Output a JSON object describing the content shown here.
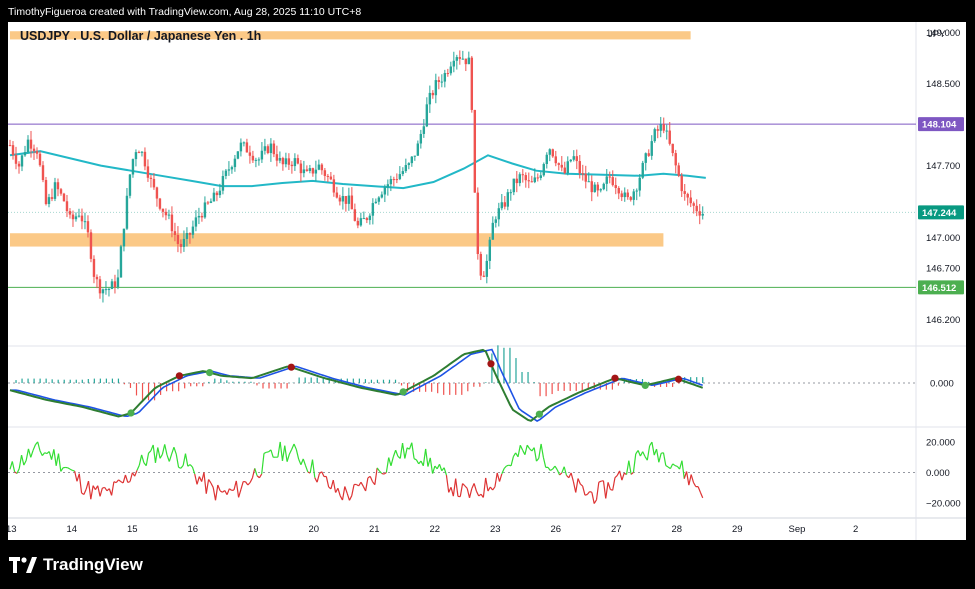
{
  "header": {
    "credit": "TimothyFigueroa created with TradingView.com, Aug 28, 2025 11:10 UTC+8",
    "title": "USDJPY . U.S. Dollar / Japanese Yen . 1h",
    "currency": "JPY"
  },
  "footer": {
    "brand": "TradingView"
  },
  "colors": {
    "bull": "#26a69a",
    "bear": "#ef5350",
    "ma": "#22b8c7",
    "zone": "#fbc987",
    "resistance_line": "#7e57c2",
    "support_line": "#4caf50",
    "macd_fast": "#2e7d32",
    "macd_slow": "#1e53e5",
    "macd_down": "#a31515",
    "osc_up": "#33dd33",
    "osc_down": "#dd3333"
  },
  "chart_data": [
    {
      "type": "candlestick",
      "title": "USDJPY . U.S. Dollar / Japanese Yen . 1h",
      "x_labels": [
        "13",
        "14",
        "15",
        "16",
        "19",
        "20",
        "21",
        "22",
        "23",
        "26",
        "27",
        "28",
        "29",
        "Sep",
        "2"
      ],
      "y_ticks": [
        146.2,
        146.7,
        147.0,
        147.7,
        148.5,
        149.0
      ],
      "y_tick_labels": [
        "146.200",
        "146.700",
        "147.000",
        "147.700",
        "148.500",
        "149.000"
      ],
      "ylim": [
        145.95,
        149.1
      ],
      "price_tags": [
        {
          "label": "148.104",
          "value": 148.104,
          "color": "#7e57c2"
        },
        {
          "label": "147.244",
          "value": 147.244,
          "color": "#089981"
        },
        {
          "label": "146.512",
          "value": 146.512,
          "color": "#4caf50"
        }
      ],
      "zones": [
        {
          "from_index": 0,
          "to_index": 11.25,
          "low": 148.93,
          "high": 149.01
        },
        {
          "from_index": 0,
          "to_index": 10.8,
          "low": 146.91,
          "high": 147.04
        }
      ],
      "hlines": [
        {
          "value": 148.104,
          "color": "#7e57c2"
        },
        {
          "value": 146.512,
          "color": "#4caf50"
        }
      ],
      "ma_line": [
        [
          0,
          147.8
        ],
        [
          0.5,
          147.84
        ],
        [
          1,
          147.77
        ],
        [
          1.5,
          147.7
        ],
        [
          2,
          147.65
        ],
        [
          2.5,
          147.6
        ],
        [
          3,
          147.55
        ],
        [
          3.5,
          147.5
        ],
        [
          4,
          147.5
        ],
        [
          4.5,
          147.53
        ],
        [
          5,
          147.55
        ],
        [
          5.5,
          147.52
        ],
        [
          6,
          147.5
        ],
        [
          6.5,
          147.48
        ],
        [
          7,
          147.54
        ],
        [
          7.5,
          147.67
        ],
        [
          7.9,
          147.8
        ],
        [
          8.3,
          147.72
        ],
        [
          8.7,
          147.65
        ],
        [
          9.2,
          147.62
        ],
        [
          9.8,
          147.61
        ],
        [
          10.4,
          147.6
        ],
        [
          10.8,
          147.62
        ],
        [
          11.2,
          147.6
        ],
        [
          11.5,
          147.58
        ]
      ],
      "candles_path": [
        [
          0,
          147.9
        ],
        [
          0.15,
          147.7
        ],
        [
          0.3,
          147.95
        ],
        [
          0.45,
          147.85
        ],
        [
          0.6,
          147.3
        ],
        [
          0.75,
          147.5
        ],
        [
          0.9,
          147.35
        ],
        [
          1.0,
          147.15
        ],
        [
          1.15,
          147.25
        ],
        [
          1.3,
          147.0
        ],
        [
          1.4,
          146.6
        ],
        [
          1.5,
          146.5
        ],
        [
          1.65,
          146.5
        ],
        [
          1.8,
          146.6
        ],
        [
          1.85,
          147.0
        ],
        [
          1.9,
          147.2
        ],
        [
          2.0,
          147.7
        ],
        [
          2.1,
          147.9
        ],
        [
          2.2,
          147.8
        ],
        [
          2.35,
          147.5
        ],
        [
          2.5,
          147.3
        ],
        [
          2.65,
          147.15
        ],
        [
          2.8,
          146.9
        ],
        [
          2.95,
          147.0
        ],
        [
          3.1,
          147.2
        ],
        [
          3.25,
          147.3
        ],
        [
          3.4,
          147.4
        ],
        [
          3.6,
          147.65
        ],
        [
          3.8,
          147.9
        ],
        [
          3.95,
          147.85
        ],
        [
          4.1,
          147.75
        ],
        [
          4.3,
          147.9
        ],
        [
          4.5,
          147.7
        ],
        [
          4.7,
          147.75
        ],
        [
          4.9,
          147.6
        ],
        [
          5.1,
          147.7
        ],
        [
          5.3,
          147.55
        ],
        [
          5.45,
          147.4
        ],
        [
          5.6,
          147.35
        ],
        [
          5.75,
          147.1
        ],
        [
          5.9,
          147.2
        ],
        [
          6.05,
          147.4
        ],
        [
          6.2,
          147.5
        ],
        [
          6.4,
          147.6
        ],
        [
          6.6,
          147.7
        ],
        [
          6.75,
          147.9
        ],
        [
          6.9,
          148.3
        ],
        [
          7.05,
          148.5
        ],
        [
          7.2,
          148.6
        ],
        [
          7.35,
          148.8
        ],
        [
          7.5,
          148.75
        ],
        [
          7.6,
          148.7
        ],
        [
          7.65,
          148.1
        ],
        [
          7.7,
          147.0
        ],
        [
          7.8,
          146.6
        ],
        [
          7.9,
          146.8
        ],
        [
          8.0,
          147.2
        ],
        [
          8.15,
          147.3
        ],
        [
          8.3,
          147.5
        ],
        [
          8.45,
          147.6
        ],
        [
          8.6,
          147.5
        ],
        [
          8.75,
          147.6
        ],
        [
          8.9,
          147.9
        ],
        [
          9.0,
          147.8
        ],
        [
          9.15,
          147.6
        ],
        [
          9.3,
          147.8
        ],
        [
          9.45,
          147.6
        ],
        [
          9.6,
          147.5
        ],
        [
          9.75,
          147.4
        ],
        [
          9.9,
          147.6
        ],
        [
          10.05,
          147.5
        ],
        [
          10.2,
          147.35
        ],
        [
          10.35,
          147.5
        ],
        [
          10.5,
          147.75
        ],
        [
          10.65,
          148.0
        ],
        [
          10.8,
          148.1
        ],
        [
          10.95,
          147.8
        ],
        [
          11.05,
          147.6
        ],
        [
          11.15,
          147.4
        ],
        [
          11.3,
          147.3
        ],
        [
          11.45,
          147.24
        ]
      ]
    },
    {
      "type": "line",
      "title": "",
      "y_ticks": [
        0.0
      ],
      "y_tick_labels": [
        "0.000"
      ],
      "markers_red": [
        2.8,
        4.65,
        7.95,
        10.0,
        11.05
      ],
      "markers_green": [
        2.0,
        3.3,
        6.5,
        8.75,
        10.5
      ]
    },
    {
      "type": "line",
      "title": "",
      "y_ticks": [
        20.0,
        0.0,
        -20.0
      ],
      "y_tick_labels": [
        "20.000",
        "0.000",
        "−20.000"
      ],
      "ylim": [
        -30,
        30
      ]
    }
  ]
}
